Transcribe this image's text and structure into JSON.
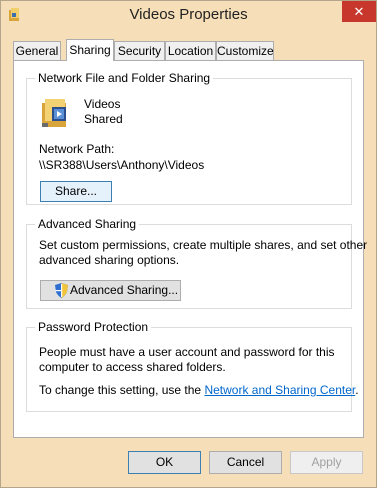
{
  "window": {
    "title": "Videos Properties",
    "close_glyph": "✕"
  },
  "tabs": [
    {
      "label": "General"
    },
    {
      "label": "Sharing"
    },
    {
      "label": "Security"
    },
    {
      "label": "Location"
    },
    {
      "label": "Customize"
    }
  ],
  "network_sharing": {
    "legend": "Network File and Folder Sharing",
    "folder_name": "Videos",
    "share_status": "Shared",
    "path_label": "Network Path:",
    "path_value": "\\\\SR388\\Users\\Anthony\\Videos",
    "share_button": "Share..."
  },
  "advanced_sharing": {
    "legend": "Advanced Sharing",
    "description_line1": "Set custom permissions, create multiple shares, and set other",
    "description_line2": "advanced sharing options.",
    "button": "Advanced Sharing..."
  },
  "password_protection": {
    "legend": "Password Protection",
    "line1": "People must have a user account and password for this",
    "line2": "computer to access shared folders.",
    "change_prefix": "To change this setting, use the ",
    "link_text": "Network and Sharing Center",
    "change_suffix": "."
  },
  "footer": {
    "ok": "OK",
    "cancel": "Cancel",
    "apply": "Apply"
  },
  "colors": {
    "titlebar": "#f6dfb8",
    "close": "#c7372c",
    "link": "#0066cc"
  }
}
